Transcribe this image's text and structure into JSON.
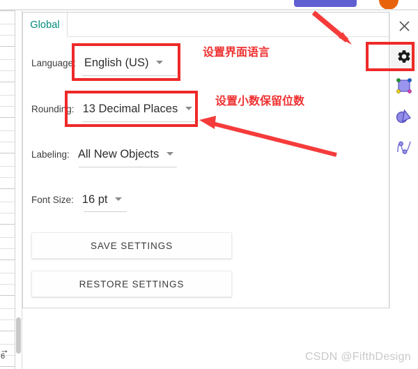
{
  "window": {
    "close_label": "✕"
  },
  "panel": {
    "tabs": [
      {
        "label": "Global",
        "active": true
      }
    ],
    "fields": [
      {
        "label": "Language:",
        "value": "English (US)",
        "caret": "chevron-down-icon"
      },
      {
        "label": "Rounding:",
        "value": "13 Decimal Places",
        "caret": "chevron-down-icon"
      },
      {
        "label": "Labeling:",
        "value": "All New Objects",
        "caret": "chevron-down-icon"
      },
      {
        "label": "Font Size:",
        "value": "16 pt",
        "caret": "chevron-down-icon"
      }
    ],
    "buttons": [
      {
        "label": "SAVE SETTINGS"
      },
      {
        "label": "RESTORE SETTINGS"
      }
    ]
  },
  "rail": {
    "icons": [
      {
        "name": "gear-icon",
        "active": true
      },
      {
        "name": "shape-square-icon",
        "active": false
      },
      {
        "name": "triangle-circle-icon",
        "active": false
      },
      {
        "name": "curve-points-icon",
        "active": false
      }
    ]
  },
  "annotations": {
    "language_note": "设置界面语言",
    "rounding_note": "设置小数保留位数",
    "highlight_color": "#ef2929",
    "arrow_color": "#f63b3b"
  },
  "spreadsheet": {
    "row_number": "6"
  },
  "watermark": {
    "text": "CSDN @FifthDesign"
  },
  "background": {
    "purple_button_color": "#5f5fd2",
    "orange_avatar_color": "#e8620c"
  }
}
